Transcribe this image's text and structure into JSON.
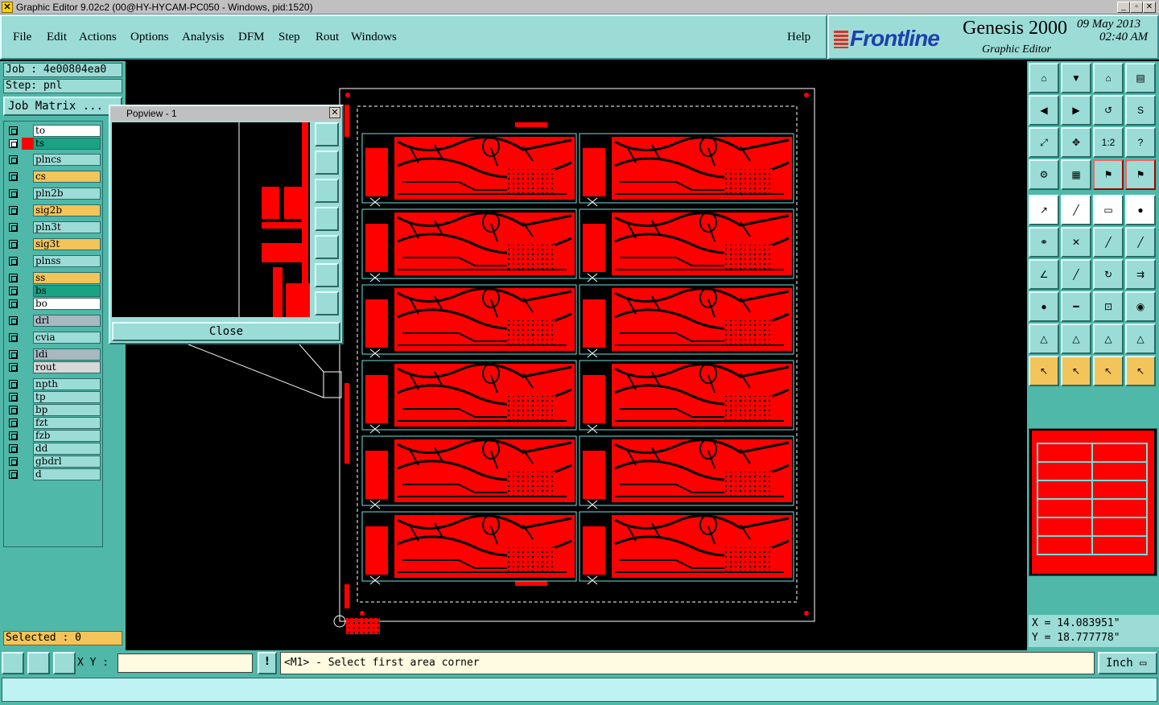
{
  "window": {
    "title": "Graphic Editor 9.02c2 (00@HY-HYCAM-PC050 - Windows, pid:1520)"
  },
  "menu": {
    "file": "File",
    "edit": "Edit",
    "actions": "Actions",
    "options": "Options",
    "analysis": "Analysis",
    "dfm": "DFM",
    "step": "Step",
    "rout": "Rout",
    "windows": "Windows",
    "help": "Help"
  },
  "brand": {
    "logo": "Frontline",
    "product": "Genesis 2000",
    "subtitle": "Graphic Editor",
    "date": "09 May 2013",
    "time": "02:40 AM"
  },
  "job": {
    "job": "Job : 4e00804ea0",
    "step": "Step: pnl",
    "matrix_button": "Job Matrix ..."
  },
  "layers": [
    {
      "name": "to",
      "color": "#ffffff"
    },
    {
      "name": "ts",
      "color": "#1aa383",
      "selected": true
    },
    {
      "name": "plncs",
      "color": "#9bdcd6"
    },
    {
      "name": "cs",
      "color": "#f3c45a"
    },
    {
      "name": "pln2b",
      "color": "#9bdcd6"
    },
    {
      "name": "sig2b",
      "color": "#f3c45a"
    },
    {
      "name": "pln3t",
      "color": "#9bdcd6"
    },
    {
      "name": "sig3t",
      "color": "#f3c45a"
    },
    {
      "name": "plnss",
      "color": "#9bdcd6"
    },
    {
      "name": "ss",
      "color": "#f3c45a"
    },
    {
      "name": "bs",
      "color": "#1aa383"
    },
    {
      "name": "bo",
      "color": "#ffffff"
    },
    {
      "name": "drl",
      "color": "#a8b8c0"
    },
    {
      "name": "cvia",
      "color": "#9bdcd6"
    },
    {
      "name": "ldi",
      "color": "#a8b8c0"
    },
    {
      "name": "rout",
      "color": "#d8d8d8"
    },
    {
      "name": "npth",
      "color": "#9bdcd6"
    },
    {
      "name": "tp",
      "color": "#9bdcd6"
    },
    {
      "name": "bp",
      "color": "#9bdcd6"
    },
    {
      "name": "fzt",
      "color": "#9bdcd6"
    },
    {
      "name": "fzb",
      "color": "#9bdcd6"
    },
    {
      "name": "dd",
      "color": "#9bdcd6"
    },
    {
      "name": "gbdrl",
      "color": "#9bdcd6"
    },
    {
      "name": "d",
      "color": "#9bdcd6"
    }
  ],
  "selected_label": "Selected : 0",
  "popview": {
    "title": "Popview - 1",
    "close_label": "Close"
  },
  "coords": {
    "x": "X =  14.083951\"",
    "y": "Y =  18.777778\""
  },
  "bottom": {
    "xy_label": "X Y :",
    "xy_value": "",
    "bang": "!",
    "prompt": "<M1> - Select first area corner",
    "units": "Inch",
    "status": ""
  },
  "colors": {
    "panel": "#4fb8a8",
    "button": "#9bdcd6",
    "copper": "#ff0000",
    "outline": "#6fe0e0",
    "selected_tool": "#f3c45a"
  }
}
